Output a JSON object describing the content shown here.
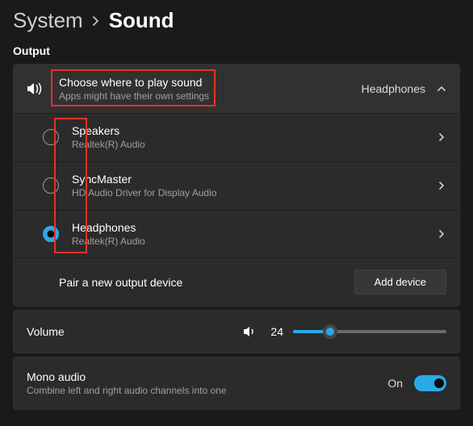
{
  "breadcrumb": {
    "parent": "System",
    "current": "Sound"
  },
  "output": {
    "section_label": "Output",
    "choose": {
      "title": "Choose where to play sound",
      "subtitle": "Apps might have their own settings",
      "selected_label": "Headphones"
    },
    "devices": [
      {
        "name": "Speakers",
        "driver": "Realtek(R) Audio",
        "selected": false
      },
      {
        "name": "SyncMaster",
        "driver": "HD Audio Driver for Display Audio",
        "selected": false
      },
      {
        "name": "Headphones",
        "driver": "Realtek(R) Audio",
        "selected": true
      }
    ],
    "pair": {
      "label": "Pair a new output device",
      "button": "Add device"
    }
  },
  "volume": {
    "label": "Volume",
    "value": 24,
    "max": 100
  },
  "mono": {
    "title": "Mono audio",
    "subtitle": "Combine left and right audio channels into one",
    "state_label": "On",
    "state": true
  },
  "colors": {
    "accent": "#29a9e8",
    "highlight": "#e53226"
  }
}
